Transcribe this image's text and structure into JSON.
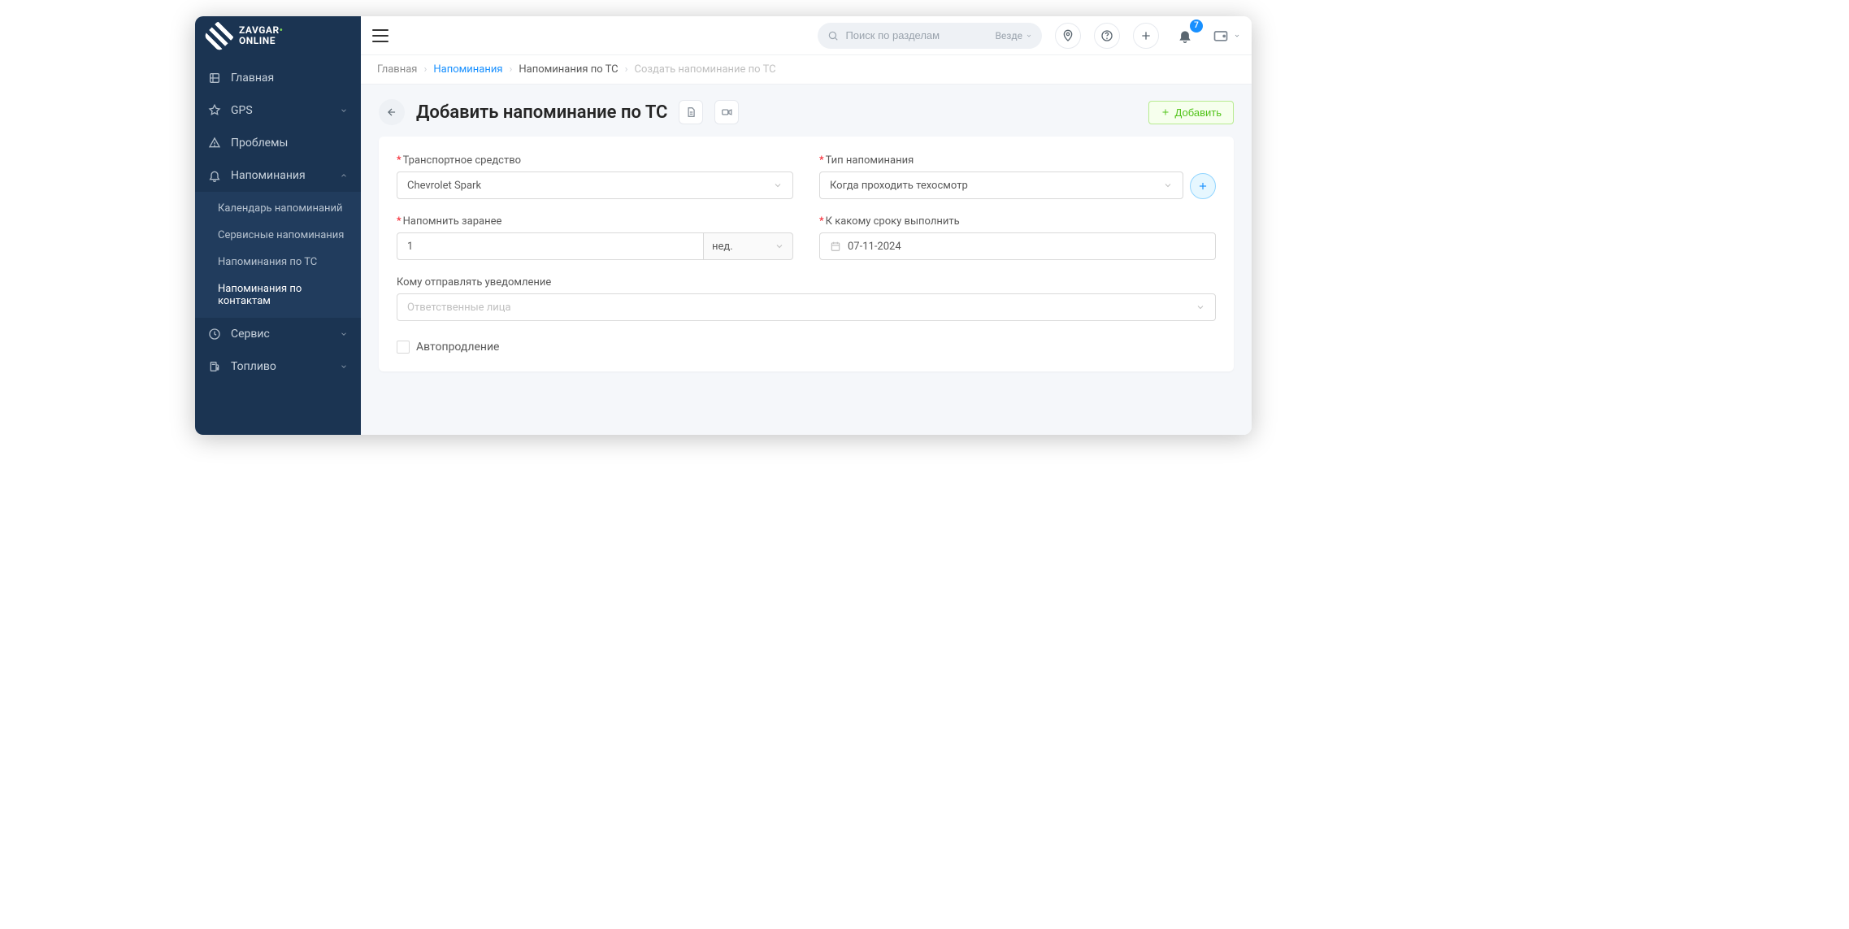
{
  "brand": {
    "line1": "ZAVGAR",
    "line2": "ONLINE"
  },
  "sidebar": {
    "items": [
      {
        "label": "Главная",
        "icon": "home"
      },
      {
        "label": "GPS",
        "icon": "gps",
        "expandable": true
      },
      {
        "label": "Проблемы",
        "icon": "problems"
      },
      {
        "label": "Напоминания",
        "icon": "bell",
        "expandable": true,
        "expanded": true
      },
      {
        "label": "Сервис",
        "icon": "service",
        "expandable": true
      },
      {
        "label": "Топливо",
        "icon": "fuel",
        "expandable": true
      }
    ],
    "sub_reminders": [
      {
        "label": "Календарь напоминаний"
      },
      {
        "label": "Сервисные напоминания"
      },
      {
        "label": "Напоминания по ТС"
      },
      {
        "label": "Напоминания по контактам"
      }
    ]
  },
  "topbar": {
    "search_placeholder": "Поиск по разделам",
    "search_scope": "Везде",
    "notif_count": "7"
  },
  "breadcrumb": {
    "home": "Главная",
    "reminders": "Напоминания",
    "vehicle_reminders": "Напоминания по ТС",
    "create": "Создать напоминание по ТС"
  },
  "page": {
    "title": "Добавить напоминание по ТС",
    "add_button": "Добавить"
  },
  "form": {
    "vehicle_label": "Транспортное средство",
    "vehicle_value": "Chevrolet Spark",
    "type_label": "Тип напоминания",
    "type_value": "Когда проходить техосмотр",
    "remind_label": "Напомнить заранее",
    "remind_value": "1",
    "remind_unit": "нед.",
    "due_label": "К какому сроку выполнить",
    "due_value": "07-11-2024",
    "notify_label": "Кому отправлять уведомление",
    "notify_placeholder": "Ответственные лица",
    "autorenew_label": "Автопродление"
  }
}
